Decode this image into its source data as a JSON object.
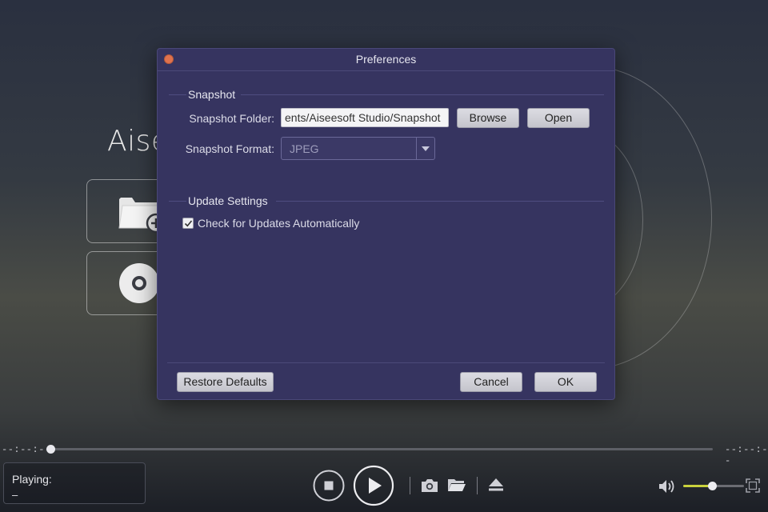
{
  "app": {
    "brand_partial": "Aise"
  },
  "dialog": {
    "title": "Preferences",
    "snapshot": {
      "group_title": "Snapshot",
      "folder_label": "Snapshot Folder:",
      "folder_value": "ents/Aiseesoft Studio/Snapshot",
      "browse_label": "Browse",
      "open_label": "Open",
      "format_label": "Snapshot Format:",
      "format_value": "JPEG"
    },
    "update": {
      "group_title": "Update Settings",
      "auto_check_label": "Check for Updates Automatically",
      "auto_check_checked": true
    },
    "footer": {
      "restore_label": "Restore Defaults",
      "cancel_label": "Cancel",
      "ok_label": "OK"
    }
  },
  "player": {
    "time_elapsed": "--:--:--",
    "time_total": "--:--:--",
    "playing_label": "Playing:",
    "playing_value": "–",
    "volume_level": 0.48,
    "progress": 0.0
  },
  "icons": {
    "close": "close-dot-icon",
    "folder_add": "folder-add-icon",
    "disc": "disc-icon",
    "stop": "stop-icon",
    "play": "play-icon",
    "snapshot": "camera-icon",
    "open_folder": "folder-icon",
    "eject": "eject-icon",
    "volume": "volume-icon",
    "fullscreen": "fullscreen-icon"
  },
  "colors": {
    "dialog_bg": "#363460",
    "close_dot": "#e0724e",
    "volume_fill": "#c9d23c"
  }
}
